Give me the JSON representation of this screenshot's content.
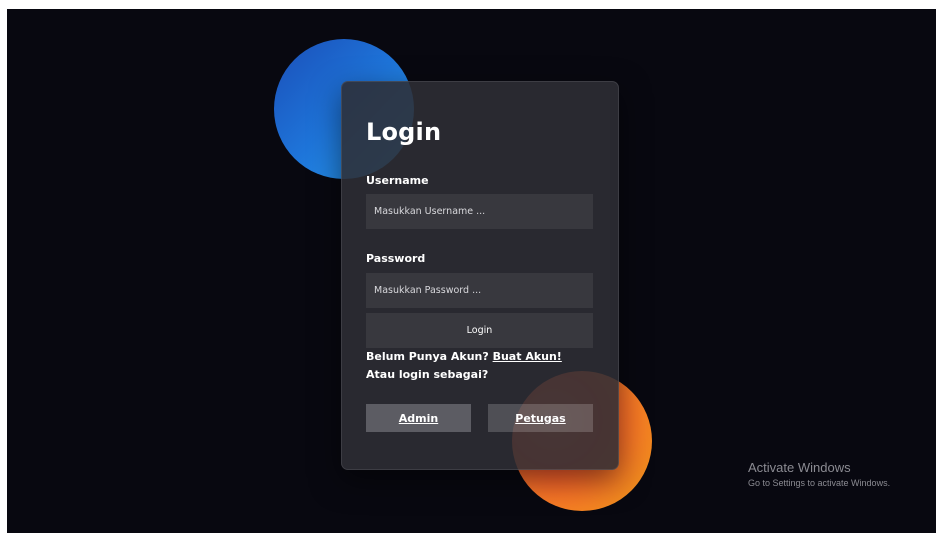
{
  "login": {
    "title": "Login",
    "username": {
      "label": "Username",
      "placeholder": "Masukkan Username ..."
    },
    "password": {
      "label": "Password",
      "placeholder": "Masukkan Password ..."
    },
    "submit_label": "Login",
    "signup_prompt": "Belum Punya Akun? ",
    "signup_link": "Buat Akun!",
    "alt_prompt": "Atau login sebagai?",
    "roles": [
      "Admin",
      "Petugas"
    ]
  },
  "watermark": {
    "title": "Activate Windows",
    "subtitle": "Go to Settings to activate Windows."
  },
  "colors": {
    "background": "#080810",
    "blue_circle": "#1e74d9",
    "orange_circle": "#ff6a3a"
  }
}
